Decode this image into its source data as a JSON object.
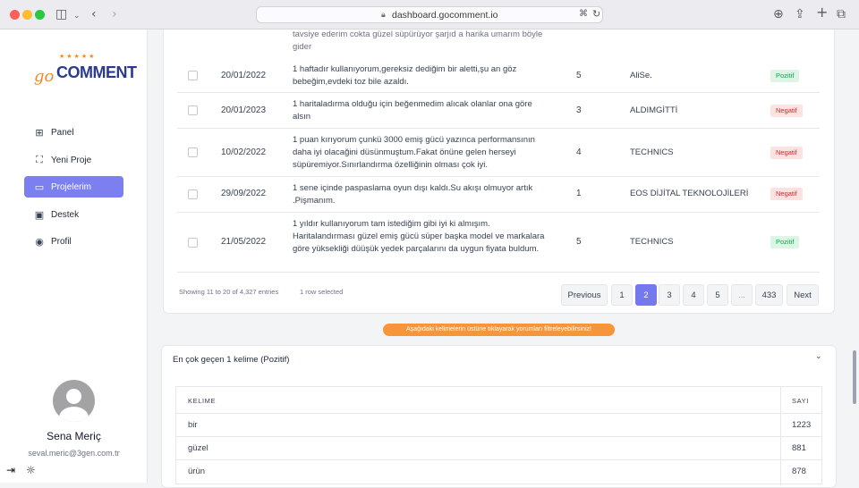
{
  "browser": {
    "url": "dashboard.gocomment.io"
  },
  "brand": {
    "logo_prefix": "go",
    "logo_main": "COMMENT",
    "logo_stars": "★★★★★"
  },
  "sidebar": {
    "items": [
      {
        "label": "Panel",
        "icon": "grid-icon"
      },
      {
        "label": "Yeni Proje",
        "icon": "scan-icon"
      },
      {
        "label": "Projelerim",
        "icon": "folder-icon"
      },
      {
        "label": "Destek",
        "icon": "inbox-icon"
      },
      {
        "label": "Profil",
        "icon": "user-circle-icon"
      }
    ],
    "active_index": 2
  },
  "user": {
    "name": "Sena Meriç",
    "email": "seval.meric@3gen.com.tr"
  },
  "table": {
    "partial_top_comment": "tavsiye ederim cokta güzel süpürüyor şarjıd a harika umarım böyle gider",
    "rows": [
      {
        "date": "20/01/2022",
        "comment": "1 haftadır kullanıyorum,gereksiz dediğim bir aletti,şu an göz bebeğim,evdeki toz bile azaldı.",
        "score": "5",
        "brand": "AliSe.",
        "sentiment": "Pozitif"
      },
      {
        "date": "20/01/2023",
        "comment": "1 haritaladırma olduğu için beğenmedim alıcak olanlar ona göre alsın",
        "score": "3",
        "brand": "ALDIMGİTTİ",
        "sentiment": "Negatif"
      },
      {
        "date": "10/02/2022",
        "comment": "1 puan kırıyorum çunkü 3000 emiş gücü yazınca performansının daha iyi olacağini düsünmuştum.Fakat önüne gelen herseyi süpüremiyor.Sınırlandırma özelliğinin olması çok iyi.",
        "score": "4",
        "brand": "TECHNICS",
        "sentiment": "Negatif"
      },
      {
        "date": "29/09/2022",
        "comment": "1 sene içinde paspaslama oyun dışı kaldı.Su akışı olmuyor artık .Pişmanım.",
        "score": "1",
        "brand": "EOS DİJİTAL TEKNOLOJİLERİ",
        "sentiment": "Negatif"
      },
      {
        "date": "21/05/2022",
        "comment": "1 yıldır kullanıyorum tam istediğim gibi iyi ki almışım. Haritalandırması güzel emiş gücü süper başka model ve markalara göre yüksekliği düüşük yedek parçalarını da uygun fiyata buldum.",
        "score": "5",
        "brand": "TECHNICS",
        "sentiment": "Pozitif"
      }
    ],
    "showing": "Showing 11 to 20 of 4,327 entries",
    "selected": "1 row selected"
  },
  "pagination": {
    "previous": "Previous",
    "pages": [
      "1",
      "2",
      "3",
      "4",
      "5",
      "...",
      "433"
    ],
    "active": "2",
    "next": "Next"
  },
  "hint": "Aşağıdaki kelimelerin üstüne tıklayarak yorumları filtreleyebilirsiniz!",
  "words": {
    "title": "En çok geçen 1 kelime (Pozitif)",
    "col_word": "KELIME",
    "col_count": "SAYI",
    "rows": [
      {
        "word": "bir",
        "count": "1223"
      },
      {
        "word": "güzel",
        "count": "881"
      },
      {
        "word": "ürün",
        "count": "878"
      }
    ]
  },
  "colors": {
    "accent": "#7678ed",
    "positive": "#16a34a",
    "negative": "#dc2626",
    "hint": "#f7953b",
    "logo_orange": "#f08a2a",
    "logo_blue": "#2b3a8c"
  }
}
